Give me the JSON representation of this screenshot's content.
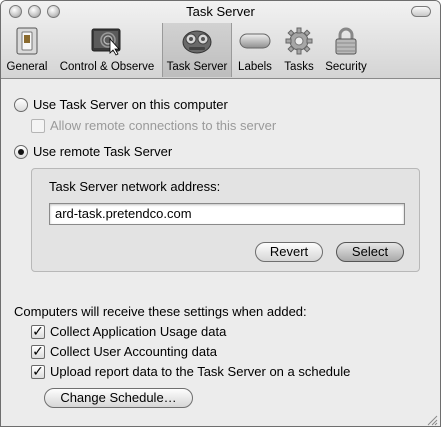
{
  "window": {
    "title": "Task Server"
  },
  "toolbar": {
    "items": [
      {
        "label": "General",
        "icon": "general-switch-icon"
      },
      {
        "label": "Control & Observe",
        "icon": "control-observe-screen-icon"
      },
      {
        "label": "Task Server",
        "icon": "task-server-icon",
        "selected": true
      },
      {
        "label": "Labels",
        "icon": "labels-pill-icon"
      },
      {
        "label": "Tasks",
        "icon": "tasks-gear-icon"
      },
      {
        "label": "Security",
        "icon": "security-lock-icon"
      }
    ]
  },
  "server_mode": {
    "local_label": "Use Task Server on this computer",
    "allow_remote_label": "Allow remote connections to this server",
    "remote_label": "Use remote Task Server",
    "selected": "remote"
  },
  "remote": {
    "address_label": "Task Server network address:",
    "address_value": "ard-task.pretendco.com",
    "revert_label": "Revert",
    "select_label": "Select"
  },
  "defaults": {
    "heading": "Computers will receive these settings when added:",
    "options": [
      {
        "label": "Collect Application Usage data",
        "checked": true
      },
      {
        "label": "Collect User Accounting data",
        "checked": true
      },
      {
        "label": "Upload report data to the Task Server on a schedule",
        "checked": true
      }
    ],
    "schedule_button": "Change Schedule…"
  }
}
